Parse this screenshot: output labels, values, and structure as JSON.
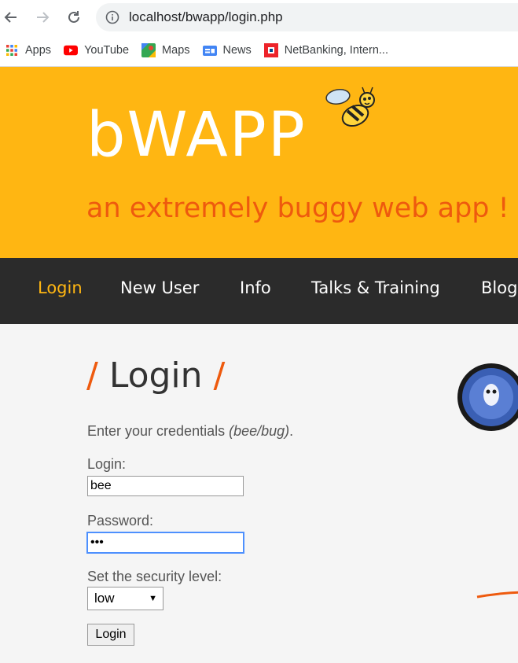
{
  "browser": {
    "url": "localhost/bwapp/login.php",
    "bookmarks": [
      {
        "label": "Apps",
        "icon": "apps-grid-icon"
      },
      {
        "label": "YouTube",
        "icon": "youtube-icon"
      },
      {
        "label": "Maps",
        "icon": "maps-icon"
      },
      {
        "label": "News",
        "icon": "news-icon"
      },
      {
        "label": "NetBanking, Intern...",
        "icon": "netbanking-icon"
      }
    ]
  },
  "header": {
    "logo": "bWAPP",
    "tagline": "an extremely buggy web app !"
  },
  "menu": {
    "items": [
      "Login",
      "New User",
      "Info",
      "Talks & Training",
      "Blog"
    ]
  },
  "page": {
    "title": "Login",
    "slash": "/",
    "instructions_prefix": "Enter your credentials ",
    "instructions_em": "(bee/bug)",
    "instructions_suffix": ".",
    "login_label": "Login:",
    "login_value": "bee",
    "password_label": "Password:",
    "password_value": "•••",
    "security_label": "Set the security level:",
    "security_value": "low",
    "login_button": "Login"
  },
  "colors": {
    "header_bg": "#ffb612",
    "accent_orange": "#ee5a0e",
    "menu_bg": "#2b2b2b"
  }
}
